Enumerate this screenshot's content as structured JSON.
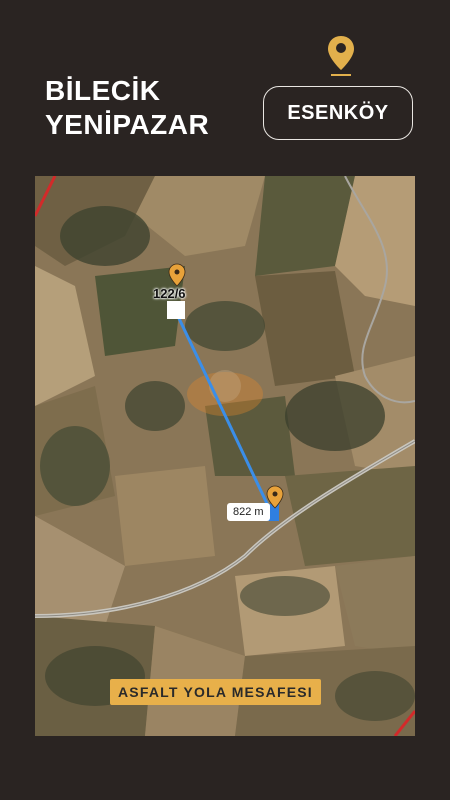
{
  "header": {
    "title_line1": "BİLECİK",
    "title_line2": "YENİPAZAR",
    "location_badge": "ESENKÖY",
    "location_icon": "map-pin-icon"
  },
  "map": {
    "parcel_label": "122/6",
    "distance_label": "822 m",
    "caption": "ASFALT YOLA MESAFESI"
  },
  "colors": {
    "background": "#2a2422",
    "accent_gold": "#e8b04a",
    "measure_line": "#3b8ee8",
    "pin": "#e8a23a"
  }
}
